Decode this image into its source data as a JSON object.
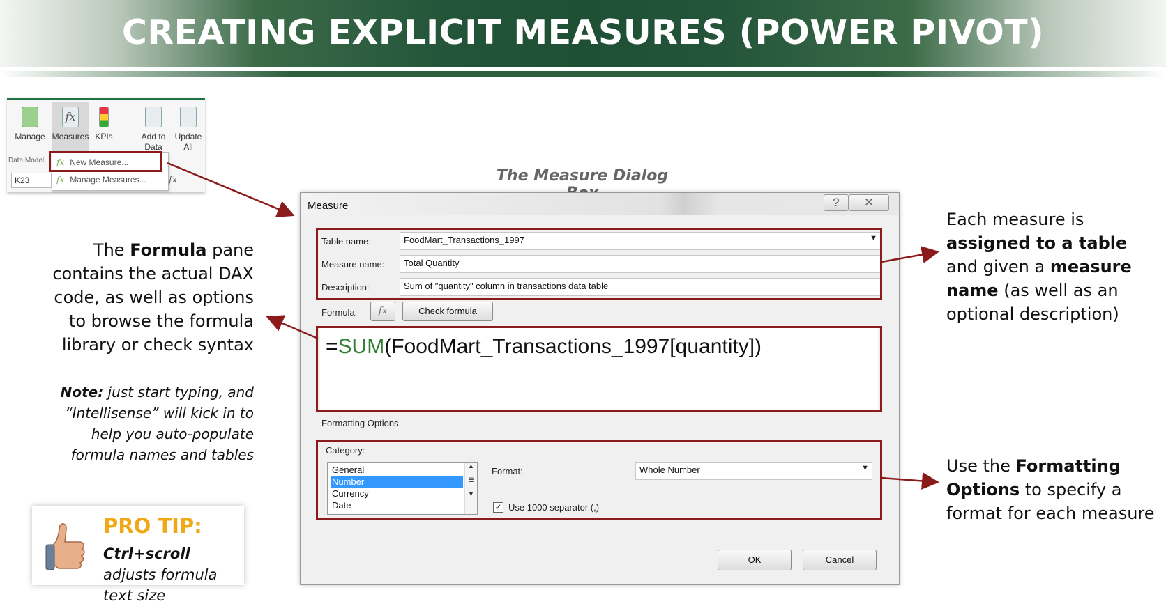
{
  "slide": {
    "title": "CREATING EXPLICIT MEASURES (POWER PIVOT)"
  },
  "ribbon": {
    "buttons": [
      {
        "label": "Manage",
        "icon": "manage-icon"
      },
      {
        "label": "Measures",
        "icon": "fx-icon",
        "sublabel": "▾"
      },
      {
        "label": "KPIs",
        "icon": "kpi-icon",
        "sublabel": "▾"
      },
      {
        "label": "Add to",
        "label2": "Data Model",
        "icon": "add-to-data-model-icon"
      },
      {
        "label": "Update",
        "label2": "All",
        "icon": "update-all-icon"
      }
    ],
    "group_label": "Data Model",
    "menu": {
      "new_measure": "New Measure...",
      "manage_measures": "Manage Measures..."
    },
    "name_box": "K23",
    "fx": "fx"
  },
  "caption": "The Measure Dialog Box",
  "dialog": {
    "title": "Measure",
    "help_glyph": "?",
    "close_glyph": "✕",
    "table_name_label": "Table name:",
    "table_name_value": "FoodMart_Transactions_1997",
    "measure_name_label": "Measure name:",
    "measure_name_value": "Total Quantity",
    "description_label": "Description:",
    "description_value": "Sum of \"quantity\" column in transactions data table",
    "formula_label": "Formula:",
    "fx_button": "fx",
    "check_formula_button": "Check formula",
    "formula": {
      "prefix": "=",
      "function": "SUM",
      "rest": "(FoodMart_Transactions_1997[quantity])"
    },
    "formatting_options_label": "Formatting Options",
    "category_label": "Category:",
    "category_items": [
      "General",
      "Number",
      "Currency",
      "Date"
    ],
    "category_selected": "Number",
    "format_label": "Format:",
    "format_value": "Whole Number",
    "separator_checkbox_label": "Use 1000 separator (,)",
    "separator_checked": true,
    "ok_button": "OK",
    "cancel_button": "Cancel"
  },
  "annotations": {
    "formula_pane": [
      "The ",
      "Formula",
      " pane contains the actual DAX code, as well as options to browse the formula library or check syntax"
    ],
    "note_label": "Note:",
    "note_text": " just start typing, and “Intellisense” will kick in to help you auto-populate formula names and tables",
    "table_assign": {
      "t1": "Each measure is ",
      "b1": "assigned to a table",
      "t2": " and given a ",
      "b2": "measure name",
      "t3": " (as well as an optional description)"
    },
    "formatting": {
      "t1": "Use the ",
      "b1": "Formatting Options",
      "t2": " to specify a format for each measure"
    }
  },
  "pro_tip": {
    "title": "PRO TIP:",
    "bold": "Ctrl+scroll",
    "text": " adjusts formula text size"
  },
  "colors": {
    "banner_green": "#1f4f34",
    "highlight_red": "#8b1a1a",
    "formula_function_green": "#2e7d32",
    "pro_tip_orange": "#f0a818",
    "selection_blue": "#3399ff"
  }
}
